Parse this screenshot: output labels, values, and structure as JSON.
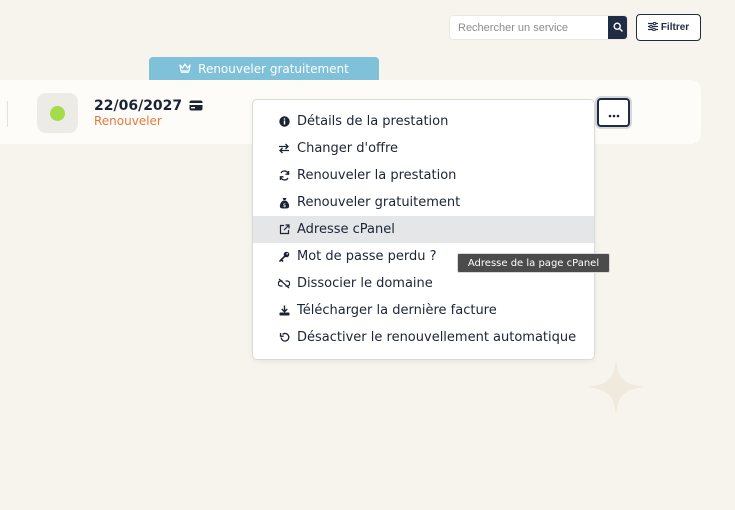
{
  "search": {
    "placeholder": "Rechercher un service",
    "button_icon": "search-icon"
  },
  "filter": {
    "label": "Filtrer",
    "icon": "sliders-icon"
  },
  "service": {
    "banner_label": "Renouveler gratuitement",
    "banner_icon": "crown-icon",
    "status_color": "#a3dd4c",
    "date": "22/06/2027",
    "payment_icon": "credit-card-icon",
    "renew_label": "Renouveler"
  },
  "more_button_icon": "ellipsis-icon",
  "menu": {
    "items": [
      {
        "label": "Détails de la prestation",
        "icon": "info-circle-icon"
      },
      {
        "label": "Changer d'offre",
        "icon": "swap-arrows-icon"
      },
      {
        "label": "Renouveler la prestation",
        "icon": "refresh-icon"
      },
      {
        "label": "Renouveler gratuitement",
        "icon": "money-bag-icon"
      },
      {
        "label": "Adresse cPanel",
        "icon": "external-link-icon",
        "highlighted": true
      },
      {
        "label": "Mot de passe perdu ?",
        "icon": "key-icon"
      },
      {
        "label": "Dissocier le domaine",
        "icon": "unlink-icon"
      },
      {
        "label": "Télécharger la dernière facture",
        "icon": "download-icon"
      },
      {
        "label": "Désactiver le renouvellement automatique",
        "icon": "undo-icon"
      }
    ]
  },
  "tooltip": "Adresse de la page cPanel",
  "colors": {
    "background": "#f7f4ee",
    "navy": "#1f2c44",
    "banner": "#7fc1d9",
    "accent_orange": "#e27a3c",
    "highlight": "#e4e6e8"
  }
}
